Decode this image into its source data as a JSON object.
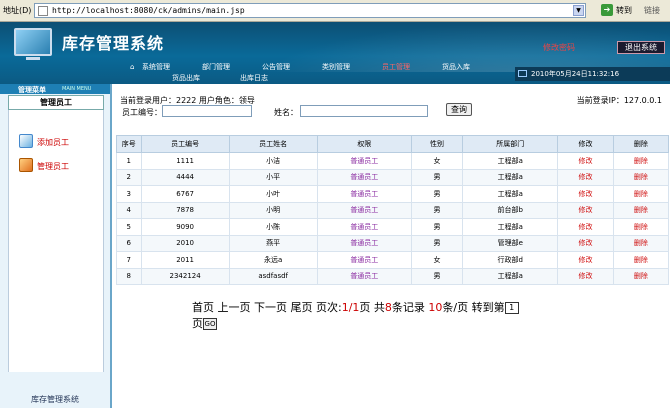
{
  "browser": {
    "address_label": "地址(D)",
    "url": "http://localhost:8080/ck/admins/main.jsp",
    "go_label": "转到",
    "links_label": "链接"
  },
  "header": {
    "title": "库存管理系统",
    "change_password": "修改密码",
    "logout": "退出系统",
    "datetime": "2010年05月24日11:32:16",
    "nav": [
      "系统管理",
      "部门管理",
      "公告管理",
      "类别管理",
      "员工管理",
      "货品入库",
      "货品出库",
      "出库日志"
    ]
  },
  "sidebar": {
    "menu_label": "管理菜单",
    "menu_label_en": "MAIN MENU",
    "section_title": "管理员工",
    "items": [
      {
        "label": "添加员工"
      },
      {
        "label": "管理员工"
      }
    ],
    "footer": "库存管理系统"
  },
  "infobar": {
    "user_text": "当前登录用户：2222   用户角色：领导",
    "ip_text": "当前登录IP：127.0.0.1"
  },
  "search": {
    "emp_no_label": "员工编号：",
    "name_label": "姓名：",
    "button": "查询"
  },
  "table": {
    "headers": [
      "序号",
      "员工编号",
      "员工姓名",
      "权限",
      "性别",
      "所属部门",
      "修改",
      "删除"
    ],
    "rows": [
      [
        "1",
        "1111",
        "小洁",
        "普通员工",
        "女",
        "工程部a",
        "修改",
        "删除"
      ],
      [
        "2",
        "4444",
        "小平",
        "普通员工",
        "男",
        "工程部a",
        "修改",
        "删除"
      ],
      [
        "3",
        "6767",
        "小叶",
        "普通员工",
        "男",
        "工程部a",
        "修改",
        "删除"
      ],
      [
        "4",
        "7878",
        "小明",
        "普通员工",
        "男",
        "前台部b",
        "修改",
        "删除"
      ],
      [
        "5",
        "9090",
        "小陈",
        "普通员工",
        "男",
        "工程部a",
        "修改",
        "删除"
      ],
      [
        "6",
        "2010",
        "燕平",
        "普通员工",
        "男",
        "管理部e",
        "修改",
        "删除"
      ],
      [
        "7",
        "2011",
        "永远a",
        "普通员工",
        "女",
        "行政部d",
        "修改",
        "删除"
      ],
      [
        "8",
        "2342124",
        "asdfasdf",
        "普通员工",
        "男",
        "工程部a",
        "修改",
        "删除"
      ]
    ]
  },
  "pager": {
    "first": "首页",
    "prev": "上一页",
    "next": "下一页",
    "last": "尾页",
    "page_label": "页次:",
    "page_current": "1/1",
    "page_unit": "页",
    "total_prefix": "共",
    "total": "8",
    "total_suffix": "条记录",
    "per_page": "10",
    "per_page_suffix": "条/页",
    "goto_label": "转到第",
    "goto_value": "1",
    "goto_suffix": "页",
    "go_button": "GO"
  }
}
